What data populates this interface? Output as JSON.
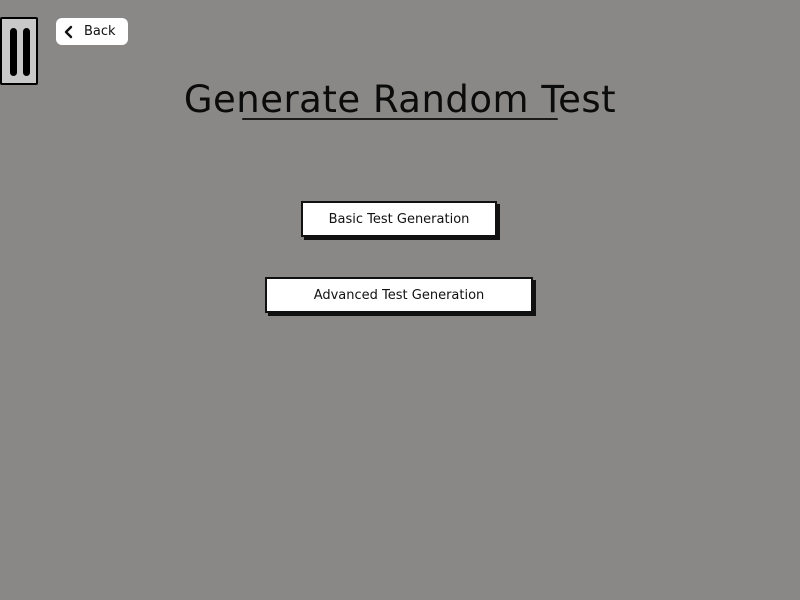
{
  "header": {
    "back_label": "Back",
    "title": "Generate Random Test"
  },
  "icons": {
    "pause": "pause-icon",
    "back": "chevron-left-icon"
  },
  "actions": {
    "basic_label": "Basic Test Generation",
    "advanced_label": "Advanced Test Generation"
  },
  "colors": {
    "background": "#8a8887",
    "button_fill": "#ffffff",
    "outline": "#111111"
  }
}
